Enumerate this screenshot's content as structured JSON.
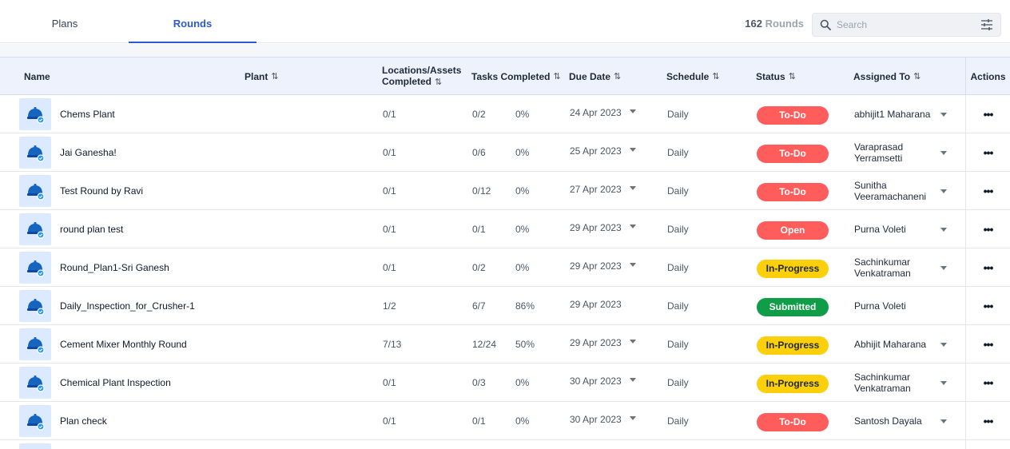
{
  "tabs": [
    {
      "label": "Plans",
      "active": false
    },
    {
      "label": "Rounds",
      "active": true
    }
  ],
  "summary": {
    "count": "162",
    "label": "Rounds"
  },
  "search": {
    "placeholder": "Search",
    "value": ""
  },
  "columns": {
    "name": "Name",
    "plant": "Plant",
    "locations_line1": "Locations/Assets",
    "locations_line2": "Completed",
    "tasks": "Tasks Completed",
    "due": "Due Date",
    "schedule": "Schedule",
    "status": "Status",
    "assigned": "Assigned To",
    "actions": "Actions"
  },
  "colors": {
    "accent": "#2b59d9",
    "todo": "#ff5c5c",
    "open": "#ff5c5c",
    "in_progress": "#fbcf0a",
    "submitted": "#0f9d48"
  },
  "rows": [
    {
      "name": "Chems Plant",
      "plant": "",
      "locations": "0/1",
      "tasks": "0/2",
      "percent": "0%",
      "due": "24 Apr 2023",
      "due_dropdown": true,
      "schedule": "Daily",
      "status": "To-Do",
      "status_key": "todo",
      "assigned_1": "abhijit1 Maharana",
      "assigned_2": "",
      "assign_dropdown": true,
      "actions": "•••"
    },
    {
      "name": "Jai Ganesha!",
      "plant": "",
      "locations": "0/1",
      "tasks": "0/6",
      "percent": "0%",
      "due": "25 Apr 2023",
      "due_dropdown": true,
      "schedule": "Daily",
      "status": "To-Do",
      "status_key": "todo",
      "assigned_1": "Varaprasad",
      "assigned_2": "Yerramsetti",
      "assign_dropdown": true,
      "actions": "•••"
    },
    {
      "name": "Test Round by Ravi",
      "plant": "",
      "locations": "0/1",
      "tasks": "0/12",
      "percent": "0%",
      "due": "27 Apr 2023",
      "due_dropdown": true,
      "schedule": "Daily",
      "status": "To-Do",
      "status_key": "todo",
      "assigned_1": "Sunitha",
      "assigned_2": "Veeramachaneni",
      "assign_dropdown": true,
      "actions": "•••"
    },
    {
      "name": "round plan test",
      "plant": "",
      "locations": "0/1",
      "tasks": "0/1",
      "percent": "0%",
      "due": "29 Apr 2023",
      "due_dropdown": true,
      "schedule": "Daily",
      "status": "Open",
      "status_key": "open",
      "assigned_1": "Purna Voleti",
      "assigned_2": "",
      "assign_dropdown": true,
      "actions": "•••"
    },
    {
      "name": "Round_Plan1-Sri Ganesh",
      "plant": "",
      "locations": "0/1",
      "tasks": "0/2",
      "percent": "0%",
      "due": "29 Apr 2023",
      "due_dropdown": true,
      "schedule": "Daily",
      "status": "In-Progress",
      "status_key": "in_progress",
      "assigned_1": "Sachinkumar",
      "assigned_2": "Venkatraman",
      "assign_dropdown": true,
      "actions": "•••"
    },
    {
      "name": "Daily_Inspection_for_Crusher-1",
      "plant": "",
      "locations": "1/2",
      "tasks": "6/7",
      "percent": "86%",
      "due": "29 Apr 2023",
      "due_dropdown": false,
      "schedule": "Daily",
      "status": "Submitted",
      "status_key": "submitted",
      "assigned_1": "Purna Voleti",
      "assigned_2": "",
      "assign_dropdown": false,
      "actions": "•••"
    },
    {
      "name": "Cement Mixer Monthly Round",
      "plant": "",
      "locations": "7/13",
      "tasks": "12/24",
      "percent": "50%",
      "due": "29 Apr 2023",
      "due_dropdown": true,
      "schedule": "Daily",
      "status": "In-Progress",
      "status_key": "in_progress",
      "assigned_1": "Abhijit Maharana",
      "assigned_2": "",
      "assign_dropdown": true,
      "actions": "•••"
    },
    {
      "name": "Chemical Plant Inspection",
      "plant": "",
      "locations": "0/1",
      "tasks": "0/3",
      "percent": "0%",
      "due": "30 Apr 2023",
      "due_dropdown": true,
      "schedule": "Daily",
      "status": "In-Progress",
      "status_key": "in_progress",
      "assigned_1": "Sachinkumar",
      "assigned_2": "Venkatraman",
      "assign_dropdown": true,
      "actions": "•••"
    },
    {
      "name": "Plan check",
      "plant": "",
      "locations": "0/1",
      "tasks": "0/1",
      "percent": "0%",
      "due": "30 Apr 2023",
      "due_dropdown": true,
      "schedule": "Daily",
      "status": "To-Do",
      "status_key": "todo",
      "assigned_1": "Santosh Dayala",
      "assigned_2": "",
      "assign_dropdown": true,
      "actions": "•••"
    }
  ]
}
